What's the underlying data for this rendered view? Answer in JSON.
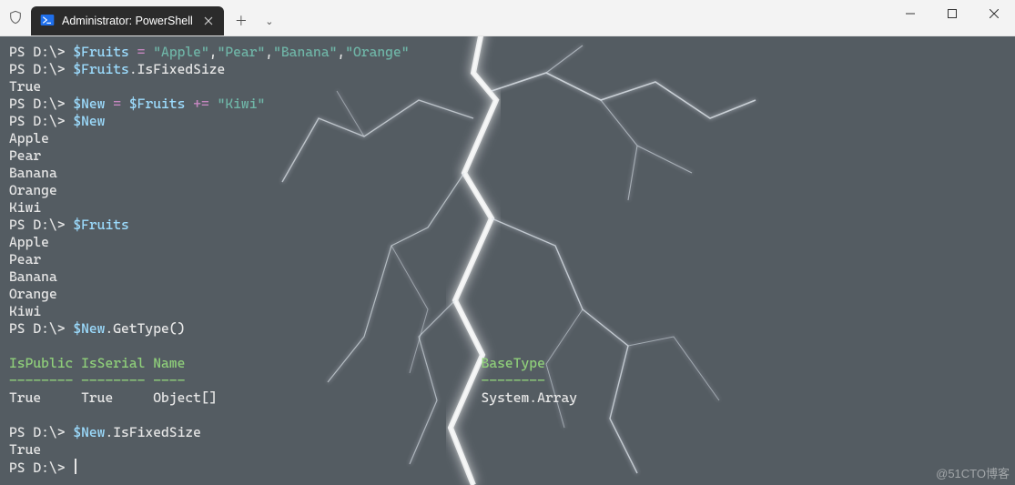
{
  "titlebar": {
    "tab_title": "Administrator: PowerShell",
    "new_tab_glyph": "＋",
    "dropdown_glyph": "⌄"
  },
  "colors": {
    "prompt_text": "#e6e6e6",
    "variable": "#9cdcfe",
    "string": "#6fb5a7",
    "operator": "#c586c0",
    "header": "#8fcf7a",
    "terminal_bg": "#555c63"
  },
  "session": {
    "prompt": "PS D:\\> ",
    "lines": [
      {
        "type": "cmd",
        "tokens": [
          {
            "t": "var",
            "v": "$Fruits"
          },
          {
            "t": "txt",
            "v": " "
          },
          {
            "t": "op",
            "v": "="
          },
          {
            "t": "txt",
            "v": " "
          },
          {
            "t": "str",
            "v": "\"Apple\""
          },
          {
            "t": "txt",
            "v": ","
          },
          {
            "t": "str",
            "v": "\"Pear\""
          },
          {
            "t": "txt",
            "v": ","
          },
          {
            "t": "str",
            "v": "\"Banana\""
          },
          {
            "t": "txt",
            "v": ","
          },
          {
            "t": "str",
            "v": "\"Orange\""
          }
        ]
      },
      {
        "type": "cmd",
        "tokens": [
          {
            "t": "var",
            "v": "$Fruits"
          },
          {
            "t": "txt",
            "v": ".IsFixedSize"
          }
        ]
      },
      {
        "type": "out",
        "text": "True"
      },
      {
        "type": "cmd",
        "tokens": [
          {
            "t": "var",
            "v": "$New"
          },
          {
            "t": "txt",
            "v": " "
          },
          {
            "t": "op",
            "v": "="
          },
          {
            "t": "txt",
            "v": " "
          },
          {
            "t": "var",
            "v": "$Fruits"
          },
          {
            "t": "txt",
            "v": " "
          },
          {
            "t": "op",
            "v": "+="
          },
          {
            "t": "txt",
            "v": " "
          },
          {
            "t": "str",
            "v": "\"Kiwi\""
          }
        ]
      },
      {
        "type": "cmd",
        "tokens": [
          {
            "t": "var",
            "v": "$New"
          }
        ]
      },
      {
        "type": "out",
        "text": "Apple"
      },
      {
        "type": "out",
        "text": "Pear"
      },
      {
        "type": "out",
        "text": "Banana"
      },
      {
        "type": "out",
        "text": "Orange"
      },
      {
        "type": "out",
        "text": "Kiwi"
      },
      {
        "type": "cmd",
        "tokens": [
          {
            "t": "var",
            "v": "$Fruits"
          }
        ]
      },
      {
        "type": "out",
        "text": "Apple"
      },
      {
        "type": "out",
        "text": "Pear"
      },
      {
        "type": "out",
        "text": "Banana"
      },
      {
        "type": "out",
        "text": "Orange"
      },
      {
        "type": "out",
        "text": "Kiwi"
      },
      {
        "type": "cmd",
        "tokens": [
          {
            "t": "var",
            "v": "$New"
          },
          {
            "t": "txt",
            "v": ".GetType()"
          }
        ]
      },
      {
        "type": "blank"
      },
      {
        "type": "hdr",
        "cols": [
          "IsPublic",
          "IsSerial",
          "Name",
          "BaseType"
        ]
      },
      {
        "type": "hdrsep",
        "cols": [
          "--------",
          "--------",
          "----",
          "--------"
        ]
      },
      {
        "type": "row",
        "cols": [
          "True",
          "True",
          "Object[]",
          "System.Array"
        ]
      },
      {
        "type": "blank"
      },
      {
        "type": "cmd",
        "tokens": [
          {
            "t": "var",
            "v": "$New"
          },
          {
            "t": "txt",
            "v": ".IsFixedSize"
          }
        ]
      },
      {
        "type": "out",
        "text": "True"
      },
      {
        "type": "prompt_only"
      }
    ],
    "table_col_starts": [
      0,
      9,
      18,
      59
    ]
  },
  "watermark": "@51CTO博客"
}
